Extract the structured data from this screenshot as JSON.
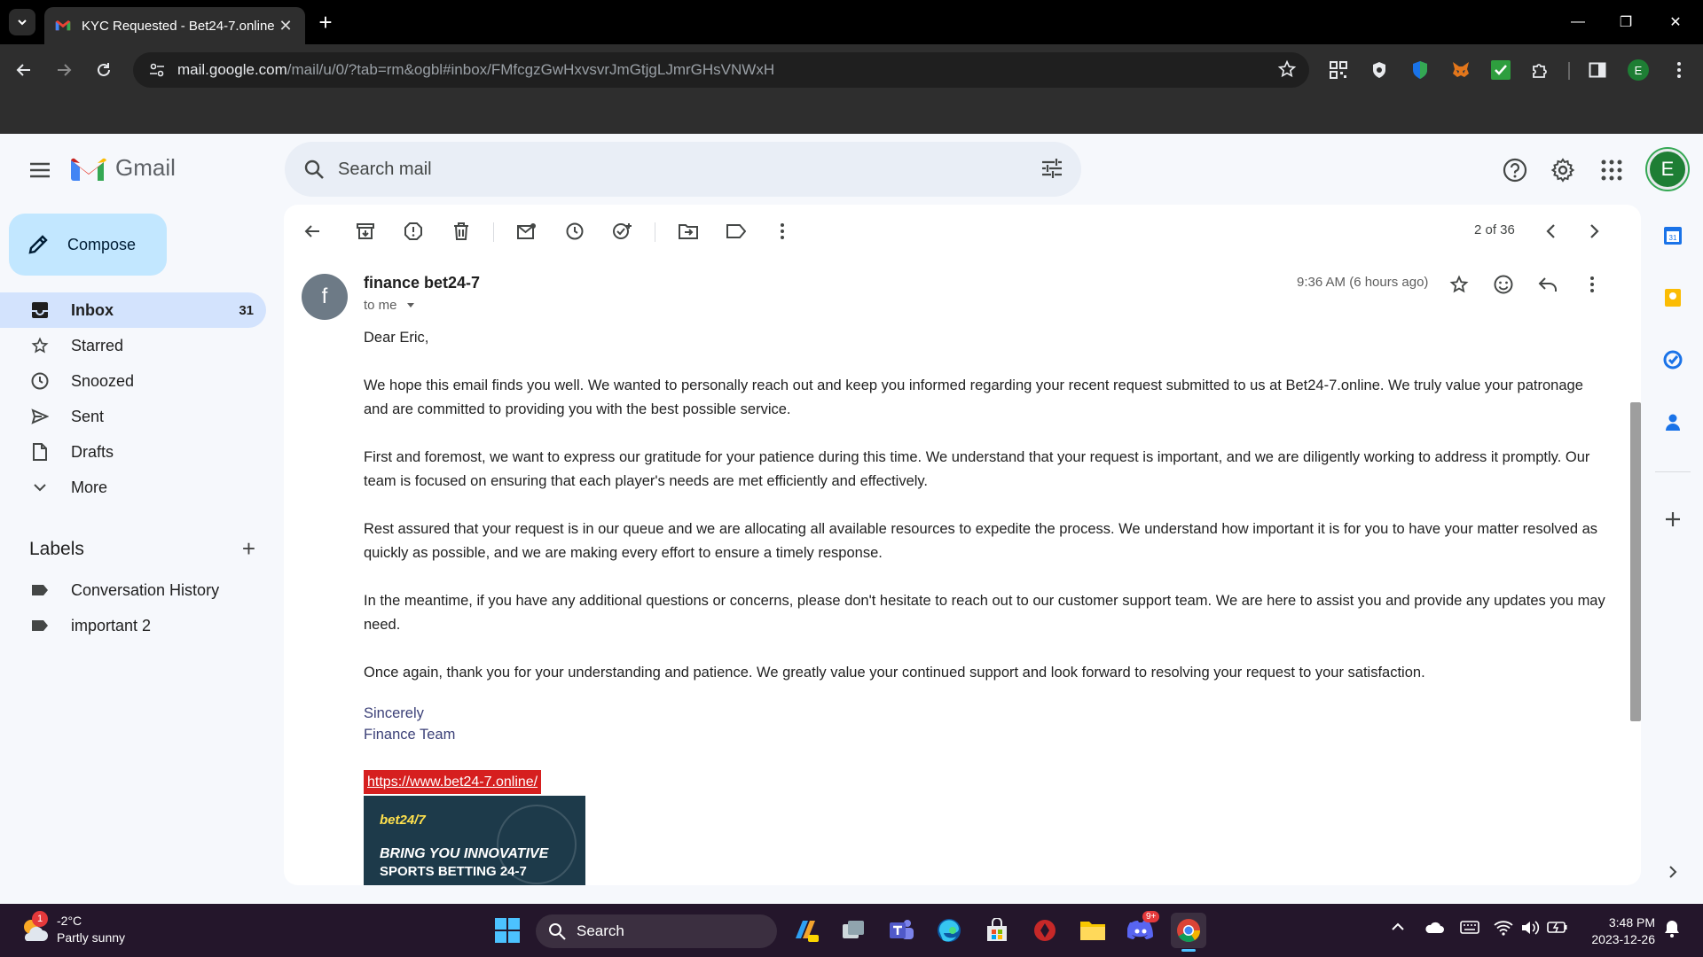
{
  "browser": {
    "tab_title": "KYC Requested - Bet24-7.online",
    "url_host": "mail.google.com",
    "url_path": "/mail/u/0/?tab=rm&ogbl#inbox/FMfcgzGwHxvsvrJmGtjgLJmrGHsVNWxH",
    "profile_initial": "E"
  },
  "gmail": {
    "brand": "Gmail",
    "search_placeholder": "Search mail",
    "compose_label": "Compose",
    "account_initial": "E",
    "nav": [
      {
        "label": "Inbox",
        "count": "31"
      },
      {
        "label": "Starred"
      },
      {
        "label": "Snoozed"
      },
      {
        "label": "Sent"
      },
      {
        "label": "Drafts"
      },
      {
        "label": "More"
      }
    ],
    "labels_heading": "Labels",
    "labels": [
      "Conversation History",
      "important 2"
    ],
    "pager": "2 of 36"
  },
  "message": {
    "sender_initial": "f",
    "sender": "finance bet24-7",
    "to": "to me",
    "time": "9:36 AM (6 hours ago)",
    "greeting": "Dear Eric,",
    "paragraphs": [
      "We hope this email finds you well. We wanted to personally reach out and keep you informed regarding your recent request submitted to us at Bet24-7.online. We truly value your patronage and are committed to providing you with the best possible service.",
      "First and foremost, we want to express our gratitude for your patience during this time. We understand that your request is important, and we are diligently working to address it promptly. Our team is focused on ensuring that each player's needs are met efficiently and effectively.",
      "Rest assured that your request is in our queue and we are allocating all available resources to expedite the process. We understand how important it is for you to have your matter resolved as quickly as possible, and we are making every effort to ensure a timely response.",
      "In the meantime, if you have any additional questions or concerns, please don't hesitate to reach out to our customer support team. We are here to assist you and provide any updates you may need.",
      "Once again, thank you for your understanding and patience. We greatly value your continued support and look forward to resolving your request to your satisfaction."
    ],
    "sign_off": "Sincerely",
    "sign_team": "Finance Team",
    "link": "https://www.bet24-7.online/",
    "banner_brand": "bet24/7",
    "banner_line1": "BRING YOU INNOVATIVE",
    "banner_line2": "SPORTS BETTING 24-7"
  },
  "taskbar": {
    "temperature": "-2°C",
    "weather": "Partly sunny",
    "weather_badge": "1",
    "search_label": "Search",
    "discord_badge": "9+",
    "time": "3:48 PM",
    "date": "2023-12-26"
  },
  "colors": {
    "accent": "#0b57d0",
    "compose_bg": "#c2e7ff",
    "active_nav": "#d3e3fd"
  }
}
